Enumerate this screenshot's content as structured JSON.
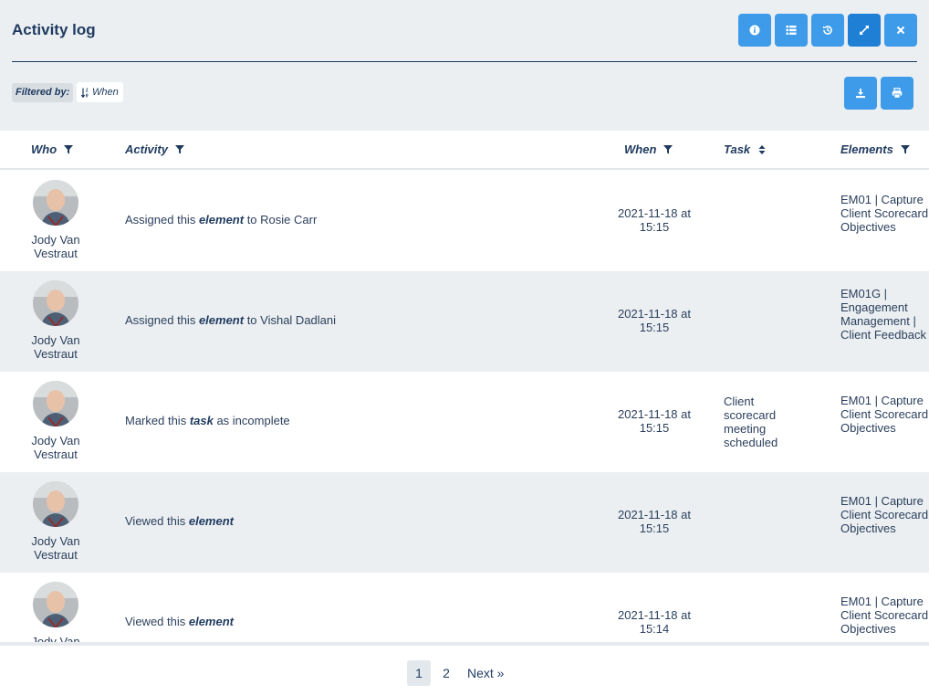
{
  "header": {
    "title": "Activity log",
    "buttons": [
      {
        "name": "info-button",
        "icon": "info-icon"
      },
      {
        "name": "list-button",
        "icon": "list-icon"
      },
      {
        "name": "history-button",
        "icon": "history-icon"
      },
      {
        "name": "expand-button",
        "icon": "expand-icon"
      },
      {
        "name": "close-button",
        "icon": "close-icon"
      }
    ],
    "accent_color": "#3d9be9"
  },
  "filter": {
    "label": "Filtered by:",
    "chip": "When",
    "chip_icon": "sort-numeric-icon"
  },
  "actions": {
    "download_icon": "download-icon",
    "print_icon": "print-icon"
  },
  "columns": {
    "who": "Who",
    "activity": "Activity",
    "when": "When",
    "task": "Task",
    "elements": "Elements"
  },
  "rows": [
    {
      "who": "Jody Van Vestraut",
      "activity_pre": "Assigned this ",
      "activity_bold": "element",
      "activity_post": " to Rosie Carr",
      "when_line1": "2021-11-18 at",
      "when_line2": "15:15",
      "task": "",
      "elements": "EM01 | Capture Client Scorecard Objectives"
    },
    {
      "who": "Jody Van Vestraut",
      "activity_pre": "Assigned this ",
      "activity_bold": "element",
      "activity_post": " to Vishal Dadlani",
      "when_line1": "2021-11-18 at",
      "when_line2": "15:15",
      "task": "",
      "elements": "EM01G | Engagement Management | Client Feedback"
    },
    {
      "who": "Jody Van Vestraut",
      "activity_pre": "Marked this ",
      "activity_bold": "task",
      "activity_post": " as incomplete",
      "when_line1": "2021-11-18 at",
      "when_line2": "15:15",
      "task": "Client scorecard meeting scheduled",
      "elements": "EM01 | Capture Client Scorecard Objectives"
    },
    {
      "who": "Jody Van Vestraut",
      "activity_pre": "Viewed this ",
      "activity_bold": "element",
      "activity_post": "",
      "when_line1": "2021-11-18 at",
      "when_line2": "15:15",
      "task": "",
      "elements": "EM01 | Capture Client Scorecard Objectives"
    },
    {
      "who": "Jody Van Vestraut",
      "activity_pre": "Viewed this ",
      "activity_bold": "element",
      "activity_post": "",
      "when_line1": "2021-11-18 at",
      "when_line2": "15:14",
      "task": "",
      "elements": "EM01 | Capture Client Scorecard Objectives"
    }
  ],
  "pagination": {
    "pages": [
      "1",
      "2"
    ],
    "current": "1",
    "next": "Next »"
  }
}
